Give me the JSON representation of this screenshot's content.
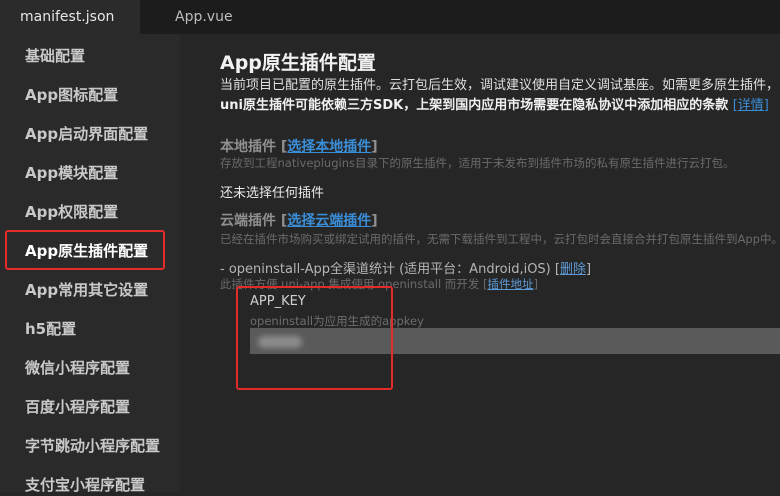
{
  "tabs": [
    {
      "label": "manifest.json"
    },
    {
      "label": "App.vue"
    }
  ],
  "sidebar": {
    "items": [
      {
        "label": "基础配置"
      },
      {
        "label": "App图标配置"
      },
      {
        "label": "App启动界面配置"
      },
      {
        "label": "App模块配置"
      },
      {
        "label": "App权限配置"
      },
      {
        "label": "App原生插件配置"
      },
      {
        "label": "App常用其它设置"
      },
      {
        "label": "h5配置"
      },
      {
        "label": "微信小程序配置"
      },
      {
        "label": "百度小程序配置"
      },
      {
        "label": "字节跳动小程序配置"
      },
      {
        "label": "支付宝小程序配置"
      }
    ],
    "active_index": 5
  },
  "main": {
    "title": "App原生插件配置",
    "desc1": "当前项目已配置的原生插件。云打包后生效，调试建议使用自定义调试基座。如需更多原生插件，",
    "desc2": "uni原生插件可能依赖三方SDK，上架到国内应用市场需要在隐私协议中添加相应的条款",
    "desc2_link": "[详情]",
    "local": {
      "title": "本地插件",
      "open": "[",
      "link": "选择本地插件",
      "close": "]",
      "hint": "存放到工程nativeplugins目录下的原生插件，适用于未发布到插件市场的私有原生插件进行云打包。",
      "empty": "还未选择任何插件"
    },
    "cloud": {
      "title": "云端插件",
      "open": "[",
      "link": "选择云端插件",
      "close": "]",
      "hint": "已经在插件市场购买或绑定试用的插件，无需下载插件到工程中，云打包时会直接合并打包原生插件到App中。"
    },
    "plugin": {
      "line": "- openinstall-App全渠道统计 (适用平台：Android,iOS)",
      "delete_open": "[",
      "delete": "删除",
      "delete_close": "]",
      "hint": "此插件方便 uni-app 集成使用 openinstall 而开发",
      "doc_open": "[",
      "doc": "插件地址",
      "doc_close": "]",
      "key_label": "APP_KEY",
      "key_hint": "openinstall为应用生成的appkey",
      "key_value": ""
    }
  }
}
